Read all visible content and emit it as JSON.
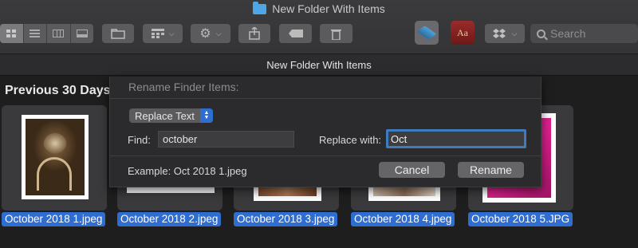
{
  "window": {
    "title": "New Folder With Items",
    "path_title": "New Folder With Items"
  },
  "toolbar": {
    "search_placeholder": "Search",
    "dictionary_label": "Aa"
  },
  "content": {
    "section_header": "Previous 30 Days",
    "files": [
      {
        "name": "October 2018 1.jpeg"
      },
      {
        "name": "October 2018 2.jpeg"
      },
      {
        "name": "October 2018 3.jpeg"
      },
      {
        "name": "October 2018 4.jpeg"
      },
      {
        "name": "October 2018 5.JPG"
      }
    ]
  },
  "dialog": {
    "title": "Rename Finder Items:",
    "mode": "Replace Text",
    "find_label": "Find:",
    "find_value": "october",
    "replace_label": "Replace with:",
    "replace_value": "Oct",
    "example": "Example: Oct 2018 1.jpeg",
    "cancel_label": "Cancel",
    "rename_label": "Rename"
  },
  "colors": {
    "selection": "#2f6dd1",
    "focus_ring": "#3f7bbf",
    "folder": "#4ea6e6"
  }
}
